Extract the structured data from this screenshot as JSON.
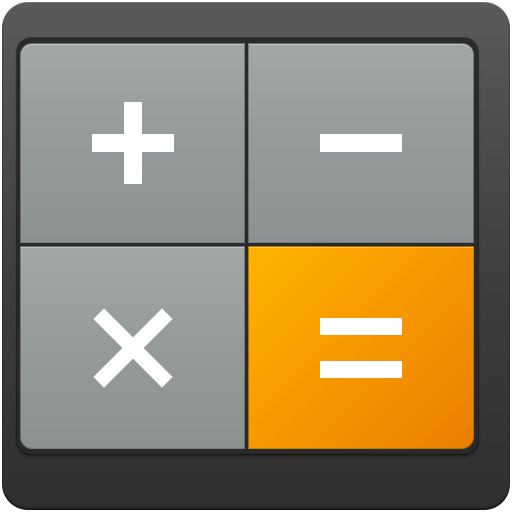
{
  "app": {
    "icon_name": "calculator-app-icon"
  },
  "colors": {
    "bezel": "#3e3e3e",
    "key_gray": "#969b9c",
    "key_orange": "#f79a00",
    "glyph": "#ffffff"
  },
  "keys": [
    {
      "operator": "add",
      "icon": "plus-icon"
    },
    {
      "operator": "subtract",
      "icon": "minus-icon"
    },
    {
      "operator": "multiply",
      "icon": "multiply-icon"
    },
    {
      "operator": "equals",
      "icon": "equals-icon"
    }
  ]
}
